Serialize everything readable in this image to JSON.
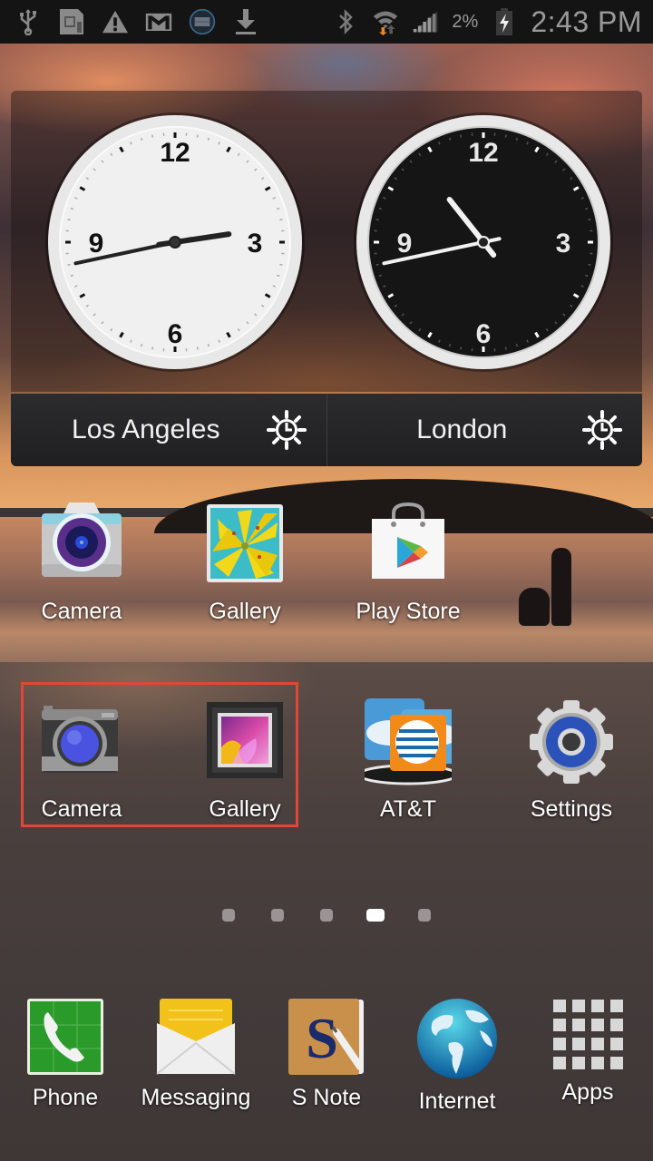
{
  "status_bar": {
    "left_icons": [
      "usb-icon",
      "sd-card-icon",
      "warning-icon",
      "gmail-icon",
      "sync-icon",
      "download-icon"
    ],
    "right_icons": [
      "bluetooth-icon",
      "wifi-icon",
      "signal-icon",
      "battery-charging-icon"
    ],
    "battery_percent": "2%",
    "time": "2:43 PM"
  },
  "clock_widget": {
    "clocks": [
      {
        "city": "Los Angeles",
        "theme": "light",
        "time": {
          "hours": 2,
          "minutes": 43
        },
        "numerals": [
          "12",
          "3",
          "6",
          "9"
        ]
      },
      {
        "city": "London",
        "theme": "dark",
        "time": {
          "hours": 10,
          "minutes": 43
        },
        "numerals": [
          "12",
          "3",
          "6",
          "9"
        ]
      }
    ],
    "settings_icon": "dst-clock-icon"
  },
  "home_screen": {
    "row1": [
      {
        "label": "Camera",
        "icon": "camera-icon"
      },
      {
        "label": "Gallery",
        "icon": "gallery-icon"
      },
      {
        "label": "Play Store",
        "icon": "play-store-icon"
      }
    ],
    "row2": [
      {
        "label": "Camera",
        "icon": "camera-icon",
        "highlighted": true
      },
      {
        "label": "Gallery",
        "icon": "gallery-icon",
        "highlighted": true
      },
      {
        "label": "AT&T",
        "icon": "att-icon"
      },
      {
        "label": "Settings",
        "icon": "settings-gear-icon"
      }
    ],
    "highlight_color": "#e0463a"
  },
  "page_indicator": {
    "total": 5,
    "current": 4
  },
  "dock": [
    {
      "label": "Phone",
      "icon": "phone-icon"
    },
    {
      "label": "Messaging",
      "icon": "messaging-icon"
    },
    {
      "label": "S Note",
      "icon": "s-note-icon"
    },
    {
      "label": "Internet",
      "icon": "globe-icon"
    },
    {
      "label": "Apps",
      "icon": "apps-grid-icon"
    }
  ]
}
